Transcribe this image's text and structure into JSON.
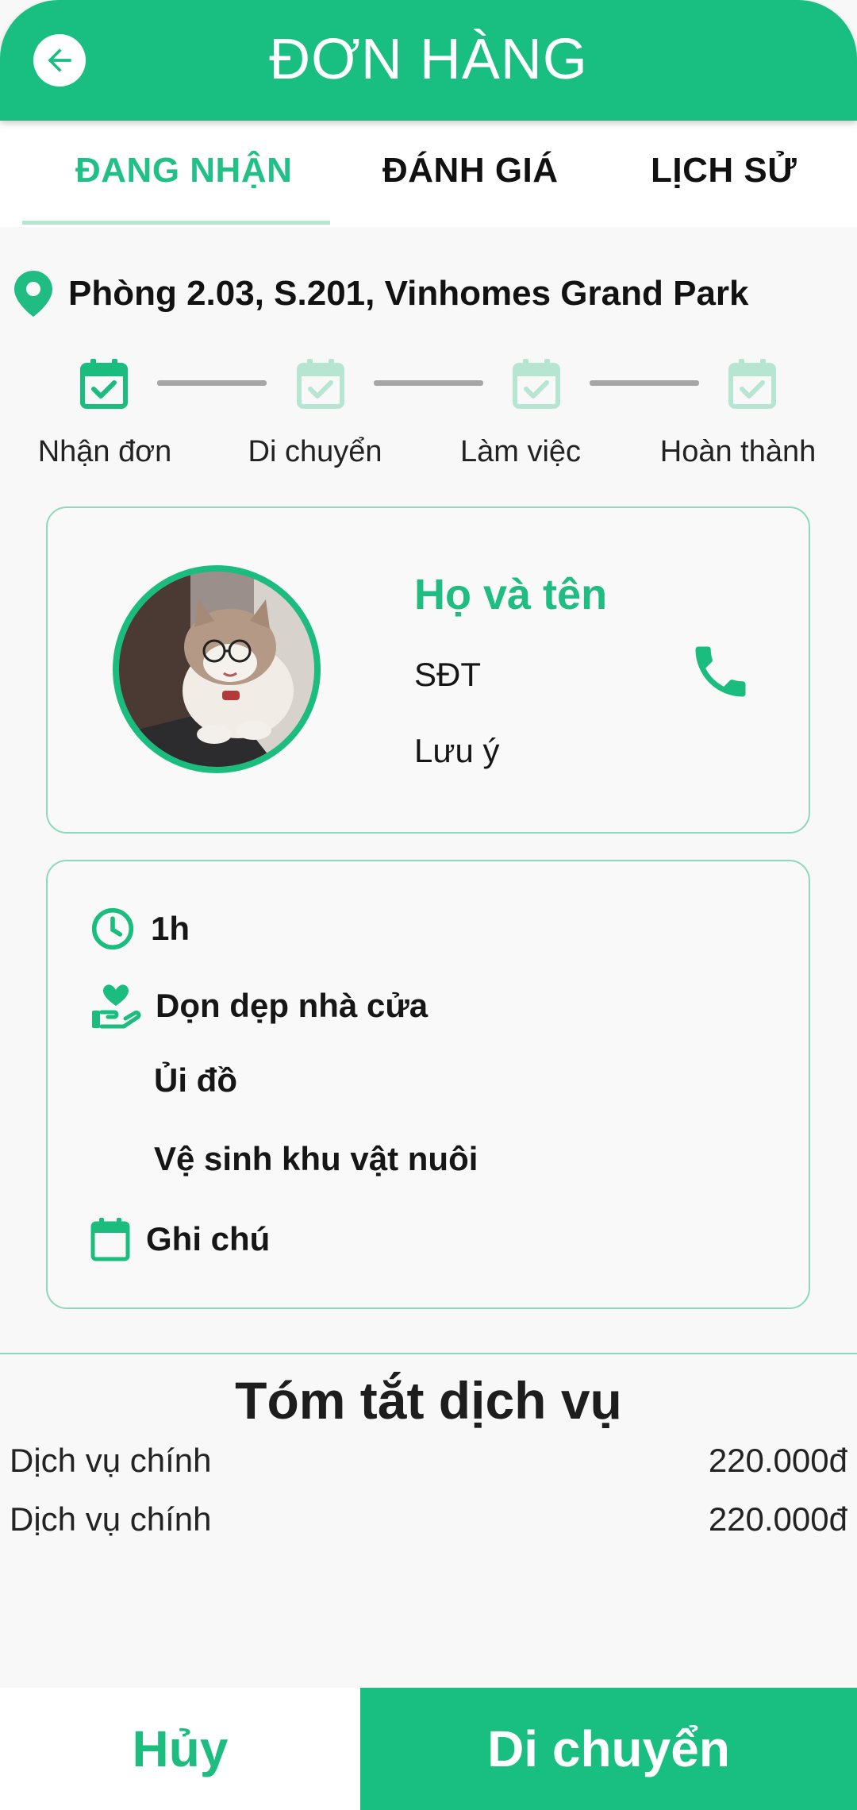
{
  "header": {
    "title": "ĐƠN HÀNG"
  },
  "tabs": [
    {
      "label": "ĐANG NHẬN",
      "active": true
    },
    {
      "label": "ĐÁNH GIÁ",
      "active": false
    },
    {
      "label": "LỊCH SỬ",
      "active": false
    }
  ],
  "address": {
    "icon": "location-pin-icon",
    "text": "Phòng 2.03, S.201, Vinhomes Grand Park"
  },
  "steps": [
    {
      "label": "Nhận đơn",
      "active": true
    },
    {
      "label": "Di chuyển",
      "active": false
    },
    {
      "label": "Làm việc",
      "active": false
    },
    {
      "label": "Hoàn thành",
      "active": false
    }
  ],
  "customer": {
    "name_label": "Họ và tên",
    "phone_label": "SĐT",
    "note_label": "Lưu ý"
  },
  "details": {
    "duration": "1h",
    "service_main": "Dọn dẹp nhà cửa",
    "extras": [
      "Ủi đồ",
      "Vệ sinh khu vật nuôi"
    ],
    "note": "Ghi chú"
  },
  "summary": {
    "title": "Tóm tắt dịch vụ",
    "rows": [
      {
        "label": "Dịch vụ chính",
        "value": "220.000đ"
      },
      {
        "label": "Dịch vụ chính",
        "value": "220.000đ"
      }
    ]
  },
  "actions": {
    "cancel": "Hủy",
    "move": "Di chuyển"
  },
  "colors": {
    "primary": "#18bf80",
    "light": "#b6e6d2",
    "line": "#a6a6a6"
  }
}
